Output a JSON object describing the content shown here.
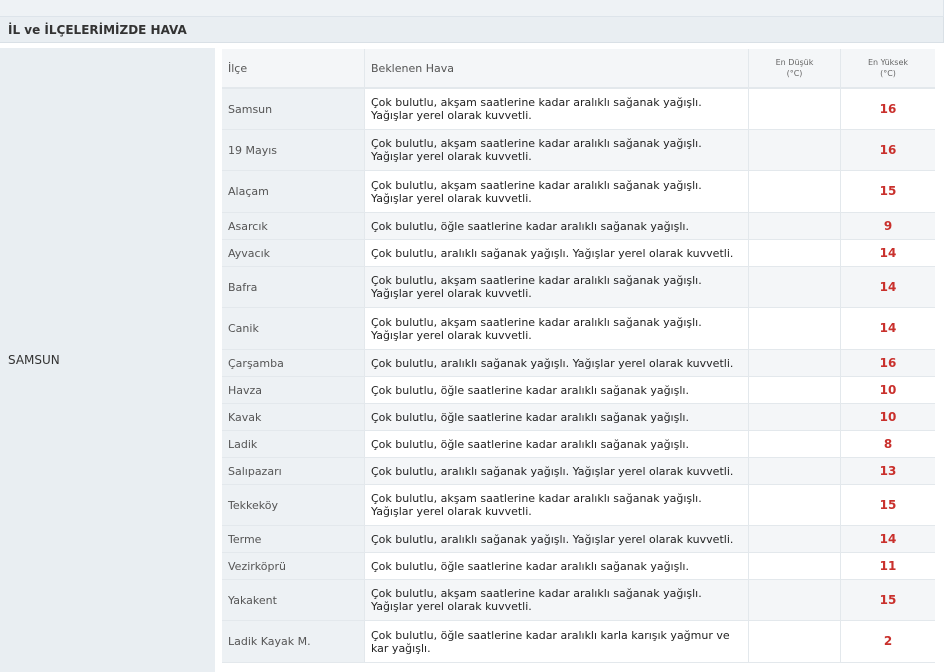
{
  "section": {
    "title": "İL ve İLÇELERİMİZDE HAVA"
  },
  "province": {
    "name": "SAMSUN"
  },
  "table": {
    "headers": {
      "district": "İlçe",
      "forecast": "Beklenen Hava",
      "min_line1": "En Düşük",
      "min_line2": "(°C)",
      "max_line1": "En Yüksek",
      "max_line2": "(°C)"
    },
    "rows": [
      {
        "district": "Samsun",
        "forecast": "Çok bulutlu, akşam saatlerine kadar aralıklı sağanak yağışlı. Yağışlar yerel olarak kuvvetli.",
        "min": "",
        "max": "16"
      },
      {
        "district": "19 Mayıs",
        "forecast": "Çok bulutlu, akşam saatlerine kadar aralıklı sağanak yağışlı. Yağışlar yerel olarak kuvvetli.",
        "min": "",
        "max": "16"
      },
      {
        "district": "Alaçam",
        "forecast": "Çok bulutlu, akşam saatlerine kadar aralıklı sağanak yağışlı. Yağışlar yerel olarak kuvvetli.",
        "min": "",
        "max": "15"
      },
      {
        "district": "Asarcık",
        "forecast": "Çok bulutlu, öğle saatlerine kadar aralıklı sağanak yağışlı.",
        "min": "",
        "max": "9"
      },
      {
        "district": "Ayvacık",
        "forecast": "Çok bulutlu, aralıklı sağanak yağışlı. Yağışlar yerel olarak kuvvetli.",
        "min": "",
        "max": "14"
      },
      {
        "district": "Bafra",
        "forecast": "Çok bulutlu, akşam saatlerine kadar aralıklı sağanak yağışlı. Yağışlar yerel olarak kuvvetli.",
        "min": "",
        "max": "14"
      },
      {
        "district": "Canik",
        "forecast": "Çok bulutlu, akşam saatlerine kadar aralıklı sağanak yağışlı. Yağışlar yerel olarak kuvvetli.",
        "min": "",
        "max": "14"
      },
      {
        "district": "Çarşamba",
        "forecast": "Çok bulutlu, aralıklı sağanak yağışlı. Yağışlar yerel olarak kuvvetli.",
        "min": "",
        "max": "16"
      },
      {
        "district": "Havza",
        "forecast": "Çok bulutlu, öğle saatlerine kadar aralıklı sağanak yağışlı.",
        "min": "",
        "max": "10"
      },
      {
        "district": "Kavak",
        "forecast": "Çok bulutlu, öğle saatlerine kadar aralıklı sağanak yağışlı.",
        "min": "",
        "max": "10"
      },
      {
        "district": "Ladik",
        "forecast": "Çok bulutlu, öğle saatlerine kadar aralıklı sağanak yağışlı.",
        "min": "",
        "max": "8"
      },
      {
        "district": "Salıpazarı",
        "forecast": "Çok bulutlu, aralıklı sağanak yağışlı. Yağışlar yerel olarak kuvvetli.",
        "min": "",
        "max": "13"
      },
      {
        "district": "Tekkeköy",
        "forecast": "Çok bulutlu, akşam saatlerine kadar aralıklı sağanak yağışlı. Yağışlar yerel olarak kuvvetli.",
        "min": "",
        "max": "15"
      },
      {
        "district": "Terme",
        "forecast": "Çok bulutlu, aralıklı sağanak yağışlı. Yağışlar yerel olarak kuvvetli.",
        "min": "",
        "max": "14"
      },
      {
        "district": "Vezirköprü",
        "forecast": "Çok bulutlu, öğle saatlerine kadar aralıklı sağanak yağışlı.",
        "min": "",
        "max": "11"
      },
      {
        "district": "Yakakent",
        "forecast": "Çok bulutlu, akşam saatlerine kadar aralıklı sağanak yağışlı. Yağışlar yerel olarak kuvvetli.",
        "min": "",
        "max": "15"
      },
      {
        "district": "Ladik Kayak M.",
        "forecast": "Çok bulutlu, öğle saatlerine kadar aralıklı karla karışık yağmur ve kar yağışlı.",
        "min": "",
        "max": "2"
      }
    ]
  },
  "colors": {
    "max_temp": "#c9302c",
    "header_bg": "#e9eef2"
  }
}
